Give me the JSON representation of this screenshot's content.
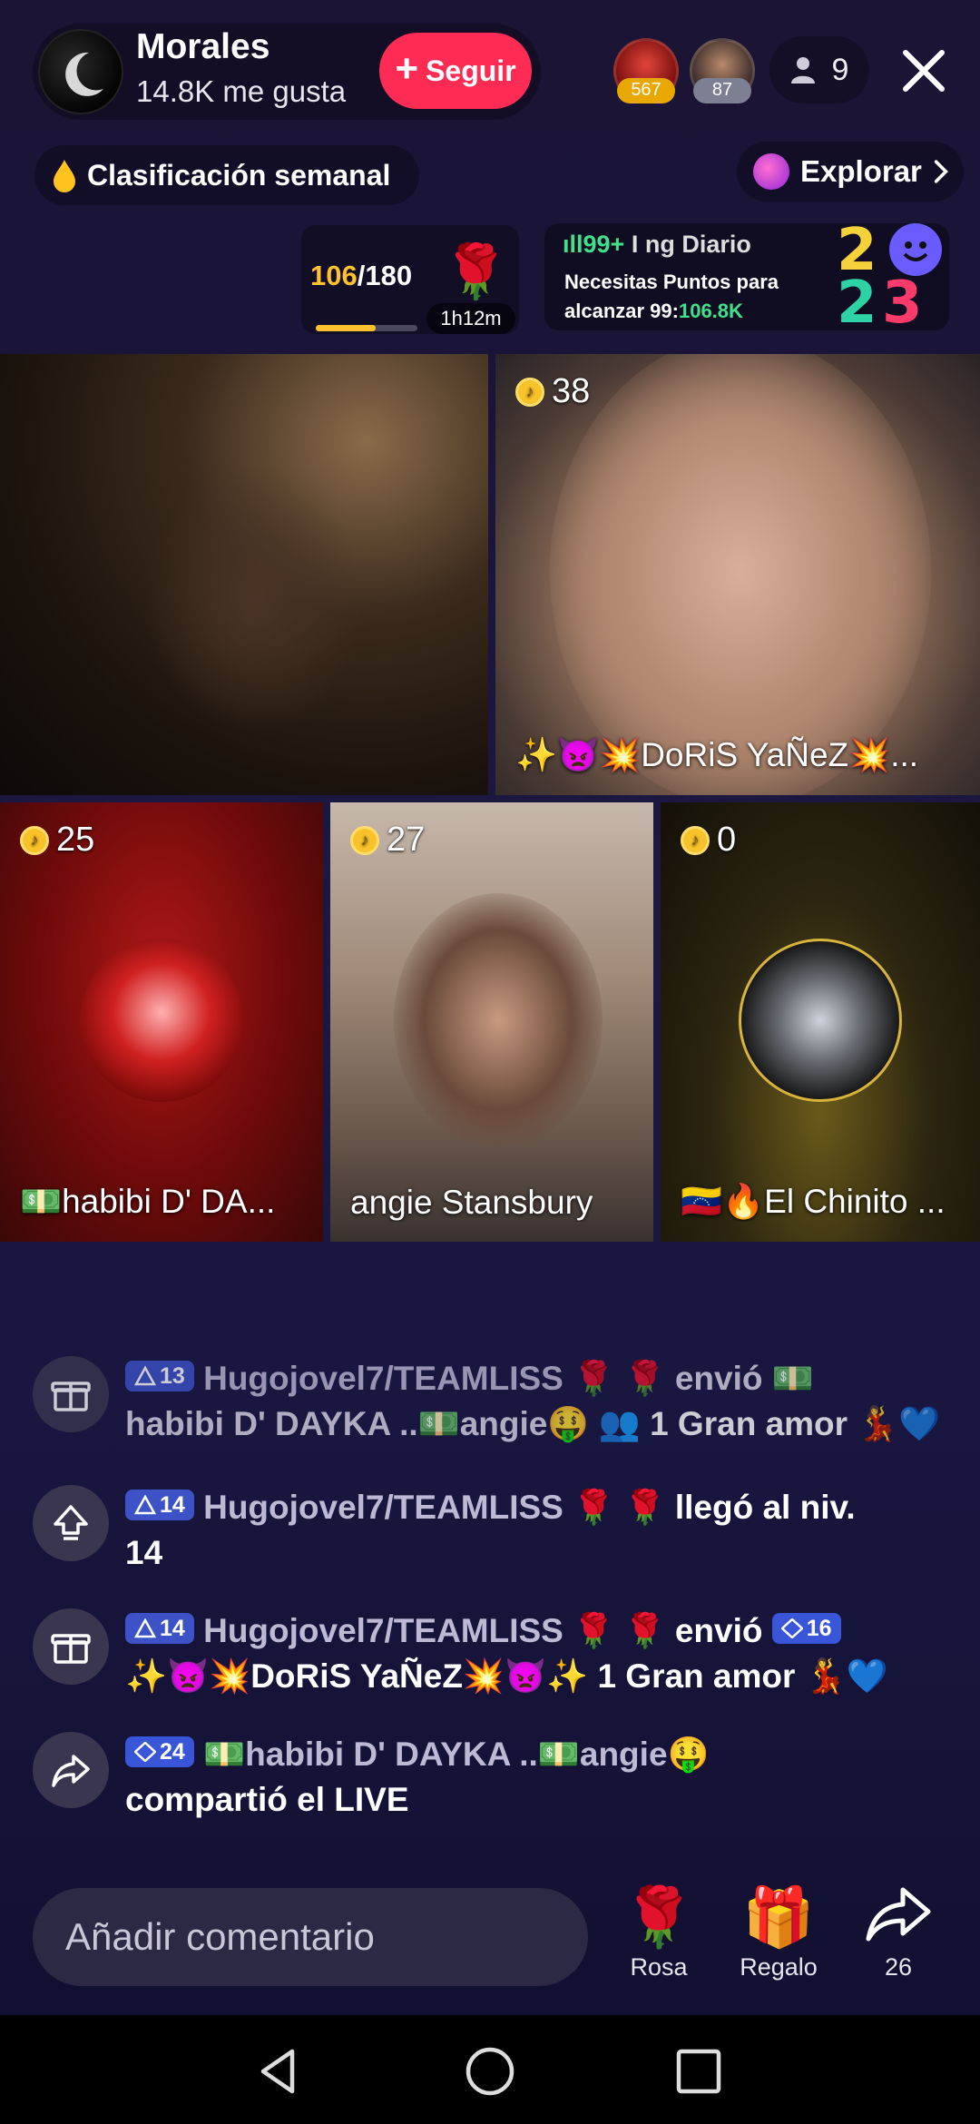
{
  "host": {
    "name": "Morales",
    "likes": "14.8K me gusta",
    "follow_label": "Seguir"
  },
  "viewers": {
    "top1_score": "567",
    "top2_score": "87",
    "count": "9"
  },
  "ranking": {
    "label": "Clasificación semanal",
    "explore_label": "Explorar"
  },
  "goal": {
    "current": "106",
    "target": "/180",
    "progress": 0.59,
    "timer": "1h12m"
  },
  "daily": {
    "head_prefix": "99+",
    "head_text": "I ng Diario",
    "line1": "Necesitas Puntos para",
    "line2_prefix": "alcanzar 99:",
    "line2_value": "106.8K",
    "year_a": "2",
    "year_b": "2",
    "year_c": "3"
  },
  "tiles": [
    {
      "score": "38",
      "name": "✨👿💥DoRiS YaÑeZ💥..."
    },
    {
      "score": "25",
      "name": "💵habibi D' DA..."
    },
    {
      "score": "27",
      "name": "angie Stansbury"
    },
    {
      "score": "0",
      "name": "🇻🇪🔥El Chinito ..."
    }
  ],
  "chat": [
    {
      "level": "13",
      "user": "Hugojovel7/TEAMLISS",
      "roses": "🌹 🌹",
      "action": "envió 💵",
      "line2": "habibi D' DAYKA ..💵angie🤑",
      "gift": "1 Gran amor 💃💙"
    },
    {
      "level": "14",
      "user": "Hugojovel7/TEAMLISS",
      "roses": "🌹 🌹",
      "action": "llegó al niv.",
      "line2": "14"
    },
    {
      "level": "14",
      "user": "Hugojovel7/TEAMLISS",
      "roses": "🌹 🌹",
      "action": "envió",
      "badge": "16",
      "line2": "✨👿💥DoRiS YaÑeZ💥👿✨",
      "gift": "1 Gran amor 💃💙"
    },
    {
      "badge": "24",
      "user": "💵habibi D' DAYKA ..💵angie🤑",
      "line2": "compartió el LIVE"
    }
  ],
  "bottom": {
    "comment_placeholder": "Añadir comentario",
    "rose_label": "Rosa",
    "gift_label": "Regalo",
    "share_count": "26"
  },
  "colors": {
    "follow": "#fe2c55",
    "coin": "#f8c22a",
    "level_badge": "#3e52c8"
  }
}
